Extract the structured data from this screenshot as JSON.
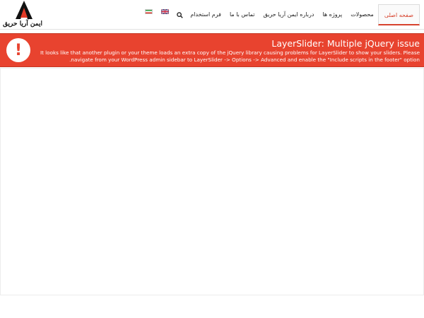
{
  "header": {
    "logo_text": "ایمن آریا حریق",
    "nav": [
      {
        "label": "صفحه اصلی",
        "active": true
      },
      {
        "label": "محصولات"
      },
      {
        "label": "پروژه ها"
      },
      {
        "label": "درباره ایمن آریا حریق"
      },
      {
        "label": "تماس با ما"
      },
      {
        "label": "فرم استخدام"
      }
    ],
    "icons": {
      "search": "search-icon",
      "lang_en": "uk-flag-icon",
      "lang_fa": "iran-flag-icon"
    }
  },
  "alert": {
    "icon_glyph": "!",
    "title": "LayerSlider: Multiple jQuery issue",
    "message_line1": "It looks like that another plugin or your theme loads an extra copy of the jQuery library causing problems for LayerSlider to show your sliders. Please",
    "message_line2": "navigate from your WordPress admin sidebar to LayerSlider -> Options -> Advanced and enable the \"Include scripts in the footer\" option.",
    "color": "#e8432f"
  },
  "colors": {
    "accent": "#d7422d",
    "alert_bg": "#e8432f"
  }
}
